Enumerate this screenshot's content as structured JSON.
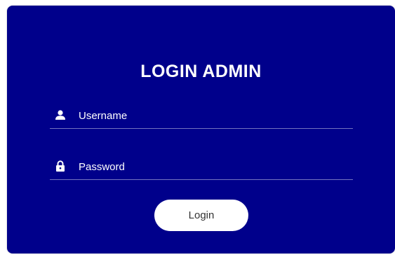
{
  "login_card": {
    "title": "LOGIN ADMIN",
    "background_color": "#00008b",
    "username": {
      "placeholder": "Username",
      "value": "",
      "icon": "user-icon"
    },
    "password": {
      "placeholder": "Password",
      "value": "",
      "icon": "lock-icon"
    },
    "login_button_label": "Login"
  }
}
